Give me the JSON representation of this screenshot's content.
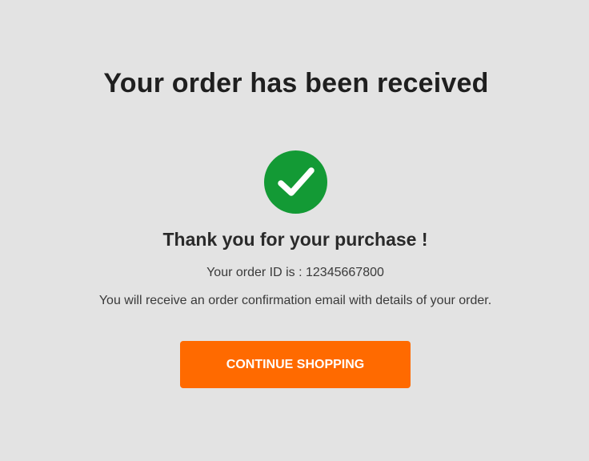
{
  "header": {
    "title": "Your order has been received"
  },
  "status": {
    "icon": "checkmark-circle-icon",
    "icon_color": "#139a35"
  },
  "main": {
    "thanks_message": "Thank you for your purchase !",
    "order_id_text": "Your order ID is : 12345667800",
    "confirmation_note": "You will receive an order confirmation email with details of your order."
  },
  "actions": {
    "continue_label": "CONTINUE SHOPPING",
    "accent_color": "#ff6a00"
  },
  "theme": {
    "background": "#e3e3e3"
  }
}
